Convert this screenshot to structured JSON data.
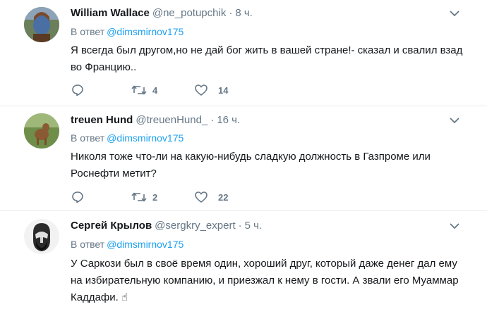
{
  "tweets": [
    {
      "name": "William Wallace",
      "handle": "@ne_potupchik",
      "separator": "·",
      "time": "8 ч.",
      "reply_prefix": "В ответ",
      "reply_handle": "@dimsmirnov175",
      "text": "Я всегда был другом,но не дай бог жить в вашей стране!- сказал и свалил взад во Францию..",
      "retweets": "4",
      "likes": "14"
    },
    {
      "name": "treuen Hund",
      "handle": "@treuenHund_",
      "separator": "·",
      "time": "16 ч.",
      "reply_prefix": "В ответ",
      "reply_handle": "@dimsmirnov175",
      "text": "Николя тоже что-ли на какую-нибудь сладкую должность в Газпроме или Роснефти метит?",
      "retweets": "2",
      "likes": "22"
    },
    {
      "name": "Сергей Крылов",
      "handle": "@sergkry_expert",
      "separator": "·",
      "time": "5 ч.",
      "reply_prefix": "В ответ",
      "reply_handle": "@dimsmirnov175",
      "text": "У Саркози был в своё время один, хороший друг, который даже денег дал ему на избирательную компанию, и приезжал к нему в гости. А звали его Муаммар Каддафи. ☝"
    }
  ],
  "icons": {
    "reply": "reply-icon",
    "retweet": "retweet-icon",
    "like": "heart-icon",
    "more": "chevron-down-icon"
  },
  "colors": {
    "text": "#14171a",
    "secondary": "#657786",
    "link": "#1da1f2",
    "divider": "#e6ecf0"
  }
}
